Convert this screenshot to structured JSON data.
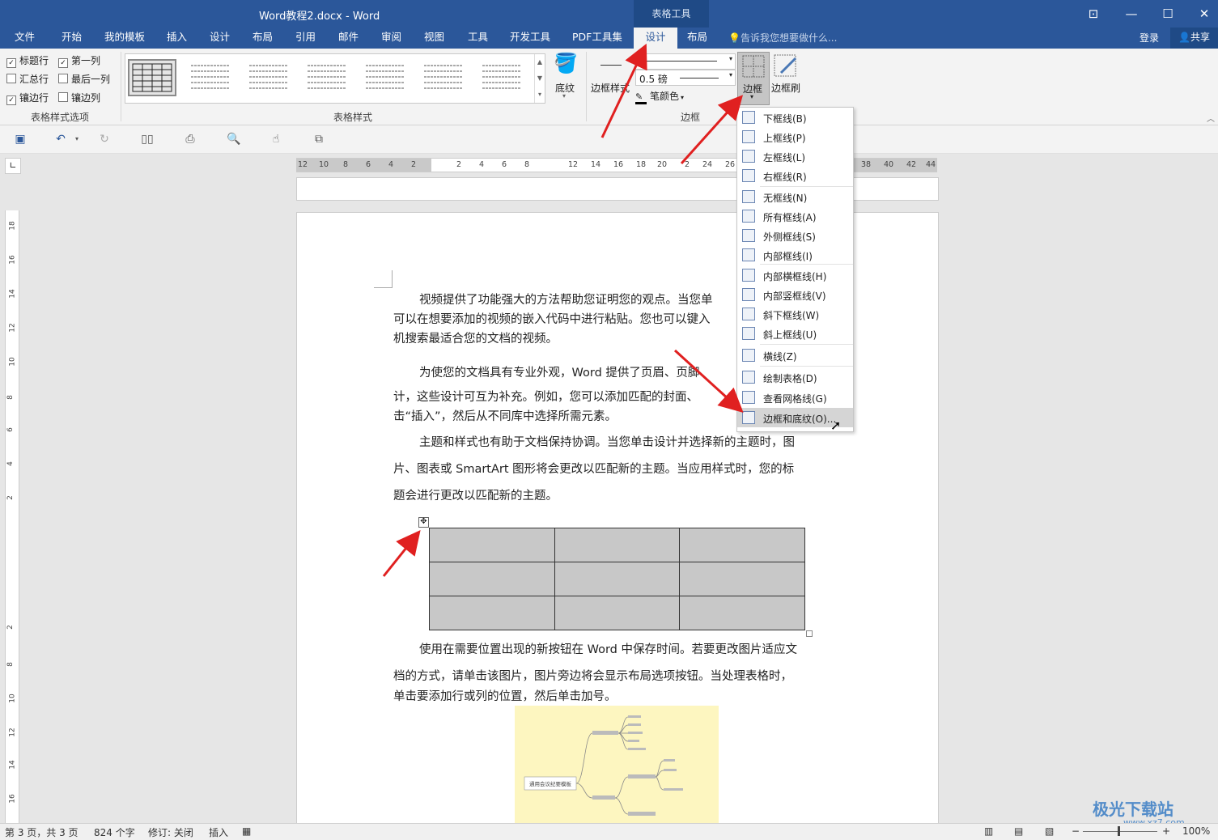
{
  "window": {
    "title": "Word教程2.docx - Word",
    "context_tab_group": "表格工具"
  },
  "menu_tabs": [
    "文件",
    "开始",
    "我的模板",
    "插入",
    "设计",
    "布局",
    "引用",
    "邮件",
    "审阅",
    "视图",
    "工具",
    "开发工具",
    "PDF工具集",
    "设计",
    "布局"
  ],
  "tell_me": "告诉我您想要做什么...",
  "login": "登录",
  "share": "共享",
  "ribbon": {
    "options": {
      "header_row": "标题行",
      "first_col": "第一列",
      "total_row": "汇总行",
      "last_col": "最后一列",
      "banded_rows": "镶边行",
      "banded_cols": "镶边列",
      "group_label": "表格样式选项",
      "checked": {
        "header_row": true,
        "first_col": true,
        "total_row": false,
        "last_col": false,
        "banded_rows": true,
        "banded_cols": false
      }
    },
    "styles_group_label": "表格样式",
    "shading_label": "底纹",
    "border_styles_label": "边框样式",
    "pen_weight": "0.5 磅",
    "pen_color_label": "笔颜色",
    "borders_label": "边框",
    "border_painter_label": "边框刷",
    "borders_group_label": "边框"
  },
  "ruler_numbers": [
    "12",
    "10",
    "8",
    "6",
    "4",
    "2",
    "2",
    "4",
    "6",
    "8",
    "12",
    "14",
    "16",
    "18",
    "20",
    "2",
    "24",
    "26",
    "38",
    "40",
    "42",
    "44"
  ],
  "vruler_numbers": [
    "18",
    "16",
    "14",
    "12",
    "10",
    "8",
    "6",
    "4",
    "2",
    "2",
    "8",
    "10",
    "12",
    "14",
    "16"
  ],
  "document": {
    "p1": [
      "视频提供了功能强大的方法帮助您证明您的观点。当您单",
      "可以在想要添加的视频的嵌入代码中进行粘贴。您也可以键入",
      "机搜索最适合您的文档的视频。"
    ],
    "p2": [
      "为使您的文档具有专业外观，Word 提供了页眉、页脚、",
      "计，这些设计可互为补充。例如，您可以添加匹配的封面、",
      "击“插入”，然后从不同库中选择所需元素。"
    ],
    "p3": [
      "主题和样式也有助于文档保持协调。当您单击设计并选择新的主题时，图",
      "片、图表或 SmartArt 图形将会更改以匹配新的主题。当应用样式时，您的标",
      "题会进行更改以匹配新的主题。"
    ],
    "p4": [
      "使用在需要位置出现的新按钮在 Word 中保存时间。若要更改图片适应文",
      "档的方式，请单击该图片，图片旁边将会显示布局选项按钮。当处理表格时，",
      "单击要添加行或列的位置，然后单击加号。"
    ],
    "mindmap_root": "通用会议纪要模板"
  },
  "border_menu": [
    {
      "label": "下框线(B)",
      "icon": "bottom-border-icon"
    },
    {
      "label": "上框线(P)",
      "icon": "top-border-icon"
    },
    {
      "label": "左框线(L)",
      "icon": "left-border-icon"
    },
    {
      "label": "右框线(R)",
      "icon": "right-border-icon"
    },
    {
      "label": "无框线(N)",
      "icon": "no-border-icon"
    },
    {
      "label": "所有框线(A)",
      "icon": "all-borders-icon"
    },
    {
      "label": "外侧框线(S)",
      "icon": "outside-borders-icon"
    },
    {
      "label": "内部框线(I)",
      "icon": "inside-borders-icon"
    },
    {
      "label": "内部横框线(H)",
      "icon": "inside-horizontal-border-icon"
    },
    {
      "label": "内部竖框线(V)",
      "icon": "inside-vertical-border-icon"
    },
    {
      "label": "斜下框线(W)",
      "icon": "diagonal-down-border-icon"
    },
    {
      "label": "斜上框线(U)",
      "icon": "diagonal-up-border-icon"
    },
    {
      "label": "横线(Z)",
      "icon": "horizontal-line-icon"
    },
    {
      "label": "绘制表格(D)",
      "icon": "draw-table-icon"
    },
    {
      "label": "查看网格线(G)",
      "icon": "view-gridlines-icon"
    },
    {
      "label": "边框和底纹(O)...",
      "icon": "borders-shading-icon"
    }
  ],
  "status": {
    "page": "第 3 页，共 3 页",
    "words": "824 个字",
    "track": "修订: 关闭",
    "mode": "插入",
    "zoom": "100%"
  },
  "watermark": "极光下载站",
  "watermark_url": "www.xz7.com",
  "colors": {
    "title_bar": "#2b579a",
    "arrow": "#e02020",
    "table_shading": "#c8c8c8"
  }
}
